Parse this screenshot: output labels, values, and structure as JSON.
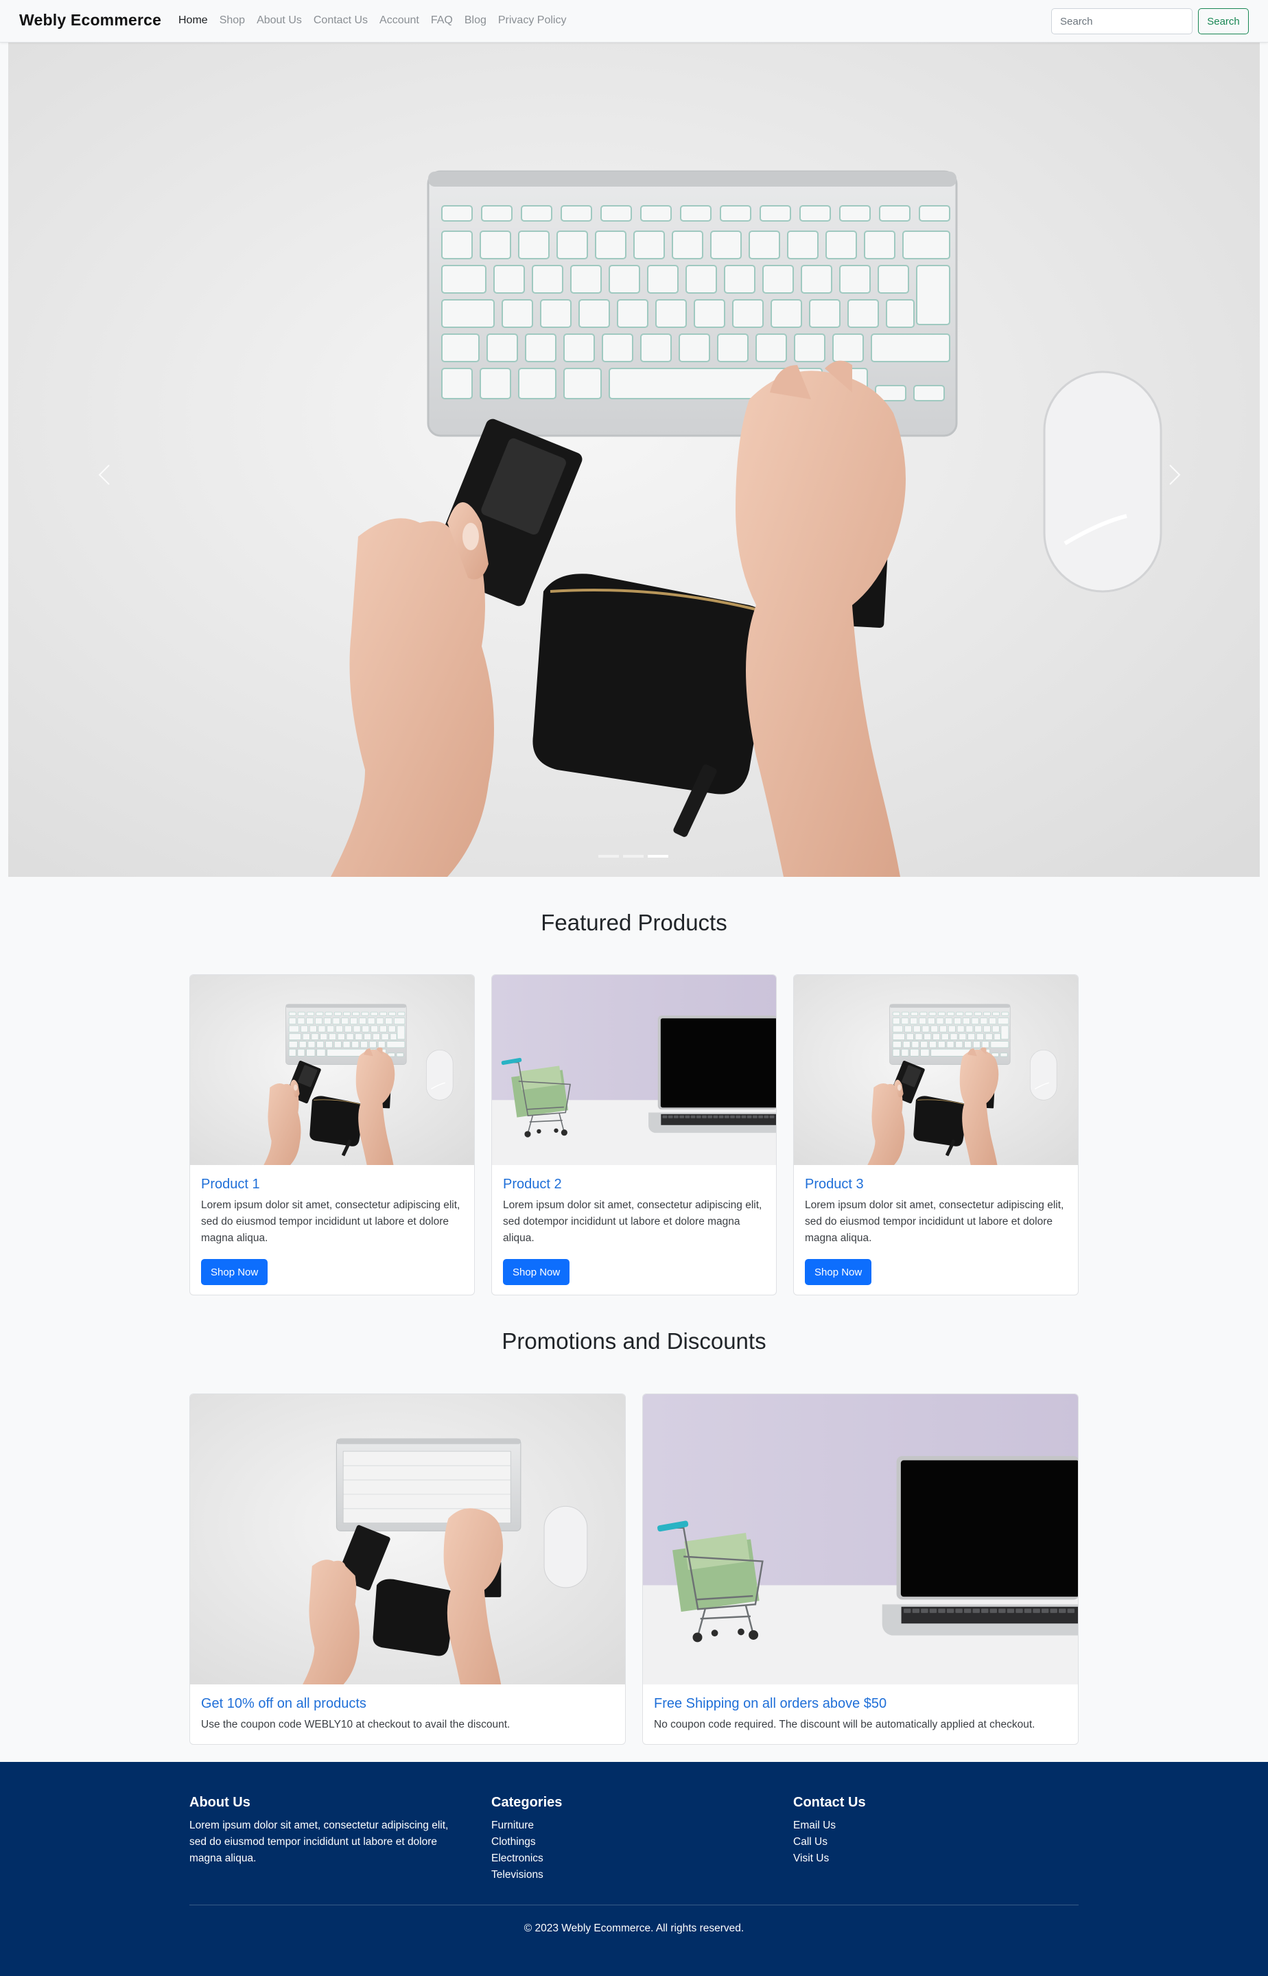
{
  "navbar": {
    "brand": "Webly Ecommerce",
    "links": [
      {
        "label": "Home",
        "active": true
      },
      {
        "label": "Shop"
      },
      {
        "label": "About Us"
      },
      {
        "label": "Contact Us"
      },
      {
        "label": "Account"
      },
      {
        "label": "FAQ"
      },
      {
        "label": "Blog"
      },
      {
        "label": "Privacy Policy"
      }
    ],
    "search_placeholder": "Search",
    "search_button": "Search"
  },
  "hero": {
    "slide_count": 3,
    "active_slide": 3,
    "prev_icon": "chevron-left-icon",
    "next_icon": "chevron-right-icon"
  },
  "featured": {
    "title": "Featured Products",
    "products": [
      {
        "name": "Product 1",
        "description": "Lorem ipsum dolor sit amet, consectetur adipiscing elit, sed do eiusmod tempor incididunt ut labore et dolore magna aliqua.",
        "button": "Shop Now",
        "image": "keyboard-hands-photo"
      },
      {
        "name": "Product 2",
        "description": "Lorem ipsum dolor sit amet, consectetur adipiscing elit, sed dotempor incididunt ut labore et dolore magna aliqua.",
        "button": "Shop Now",
        "image": "cart-laptop-photo"
      },
      {
        "name": "Product 3",
        "description": "Lorem ipsum dolor sit amet, consectetur adipiscing elit, sed do eiusmod tempor incididunt ut labore et dolore magna aliqua.",
        "button": "Shop Now",
        "image": "keyboard-hands-photo"
      }
    ]
  },
  "promotions": {
    "title": "Promotions and Discounts",
    "items": [
      {
        "title": "Get 10% off on all products",
        "text": "Use the coupon code WEBLY10 at checkout to avail the discount.",
        "image": "keyboard-hands-photo"
      },
      {
        "title": "Free Shipping on all orders above $50",
        "text": "No coupon code required. The discount will be automatically applied at checkout.",
        "image": "cart-laptop-photo"
      }
    ]
  },
  "footer": {
    "about": {
      "heading": "About Us",
      "text": "Lorem ipsum dolor sit amet, consectetur adipiscing elit, sed do eiusmod tempor incididunt ut labore et dolore magna aliqua."
    },
    "categories": {
      "heading": "Categories",
      "links": [
        "Furniture",
        "Clothings",
        "Electronics",
        "Televisions"
      ]
    },
    "contact": {
      "heading": "Contact Us",
      "links": [
        "Email Us",
        "Call Us",
        "Visit Us"
      ]
    },
    "copyright": "© 2023 Webly Ecommerce. All rights reserved."
  },
  "colors": {
    "primary": "#0d6efd",
    "success": "#198754",
    "footer_bg": "#012d66",
    "link_title": "#1f6fd8",
    "page_bg": "#f8f9fa"
  }
}
